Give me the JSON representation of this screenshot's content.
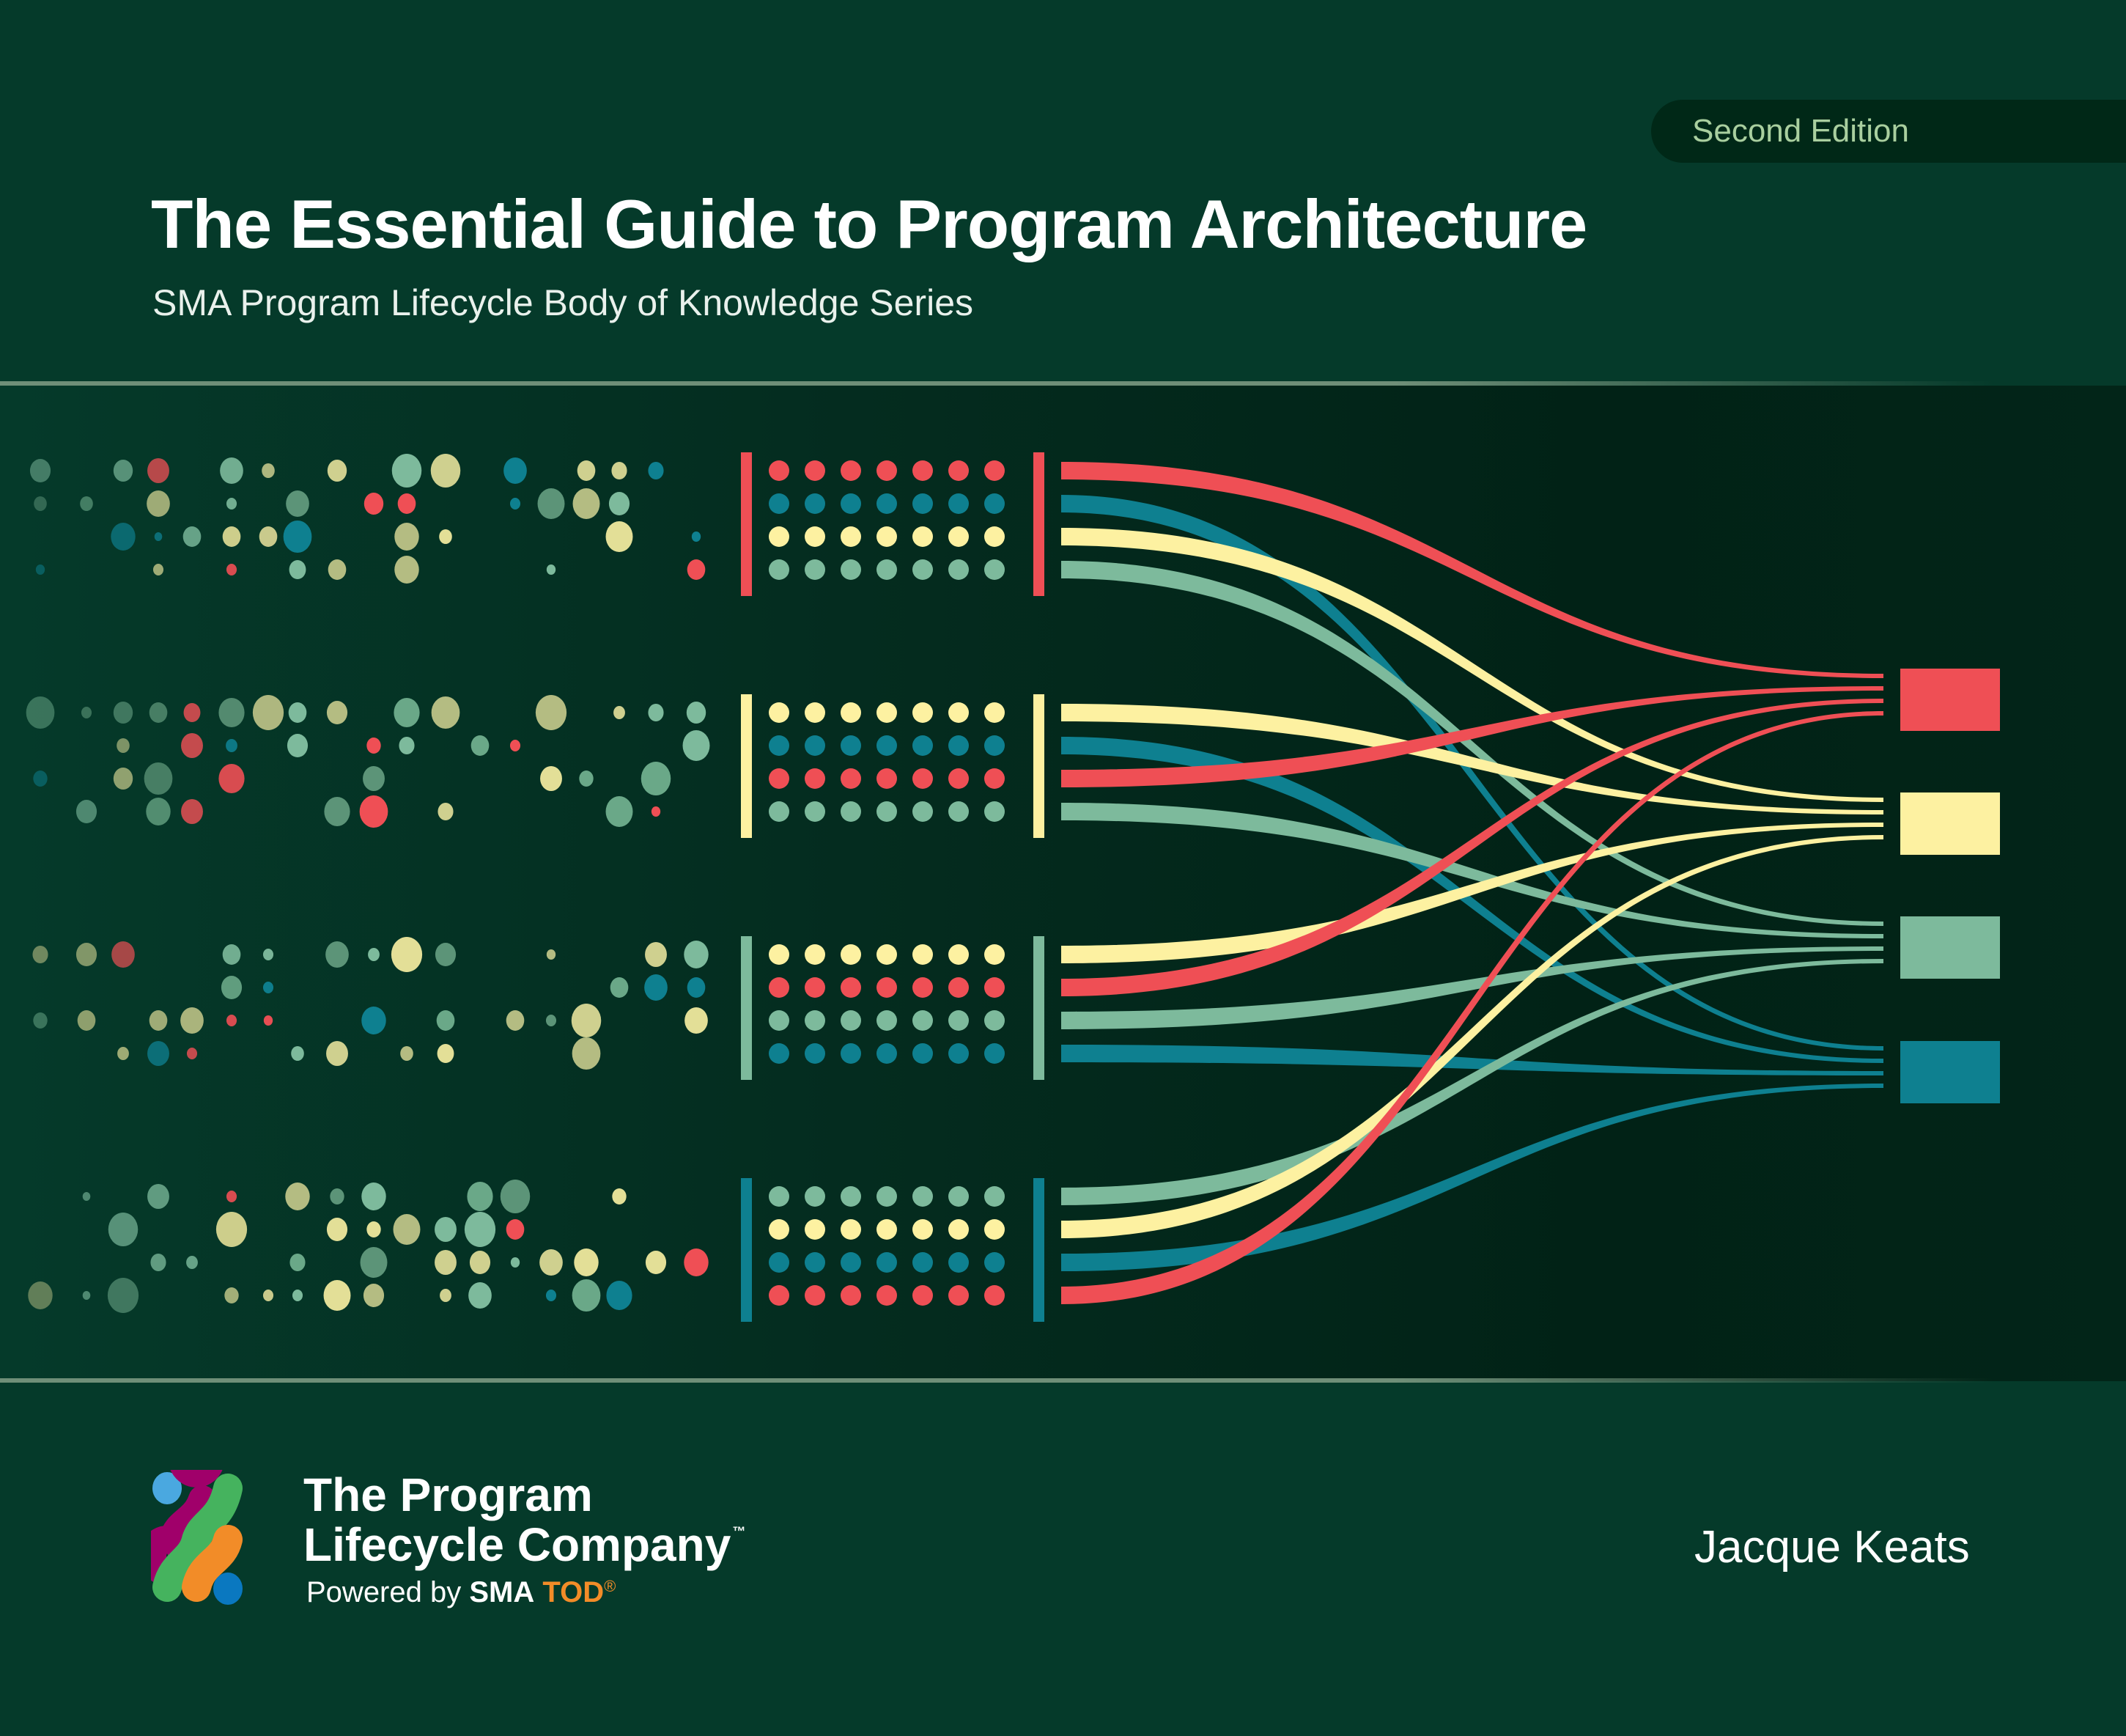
{
  "edition_badge": {
    "label": "Second Edition"
  },
  "book": {
    "title": "The Essential Guide to Program Architecture",
    "subtitle": "SMA Program Lifecycle Body of Knowledge Series",
    "author": "Jacque Keats"
  },
  "publisher": {
    "line1": "The Program",
    "line2": "Lifecycle Company",
    "trademark": "™",
    "powered_by": "Powered by",
    "sma": "SMA",
    "tod": "TOD",
    "registered": "®",
    "logo_colors": [
      "#4aa8e0",
      "#a0006a",
      "#45b35e",
      "#f28c28",
      "#0a78c0"
    ]
  },
  "palette": {
    "red": "#ef4f55",
    "teal": "#0e8090",
    "yellow": "#fdf1a1",
    "mint": "#7dba9c"
  },
  "illustration": {
    "groups": [
      {
        "bar_color": "red",
        "rows": [
          "red",
          "teal",
          "yellow",
          "mint"
        ]
      },
      {
        "bar_color": "yellow",
        "rows": [
          "yellow",
          "teal",
          "red",
          "mint"
        ]
      },
      {
        "bar_color": "mint",
        "rows": [
          "yellow",
          "red",
          "mint",
          "teal"
        ]
      },
      {
        "bar_color": "teal",
        "rows": [
          "mint",
          "yellow",
          "teal",
          "red"
        ]
      }
    ],
    "dots_per_row": 7,
    "targets": [
      "red",
      "yellow",
      "mint",
      "teal"
    ]
  }
}
